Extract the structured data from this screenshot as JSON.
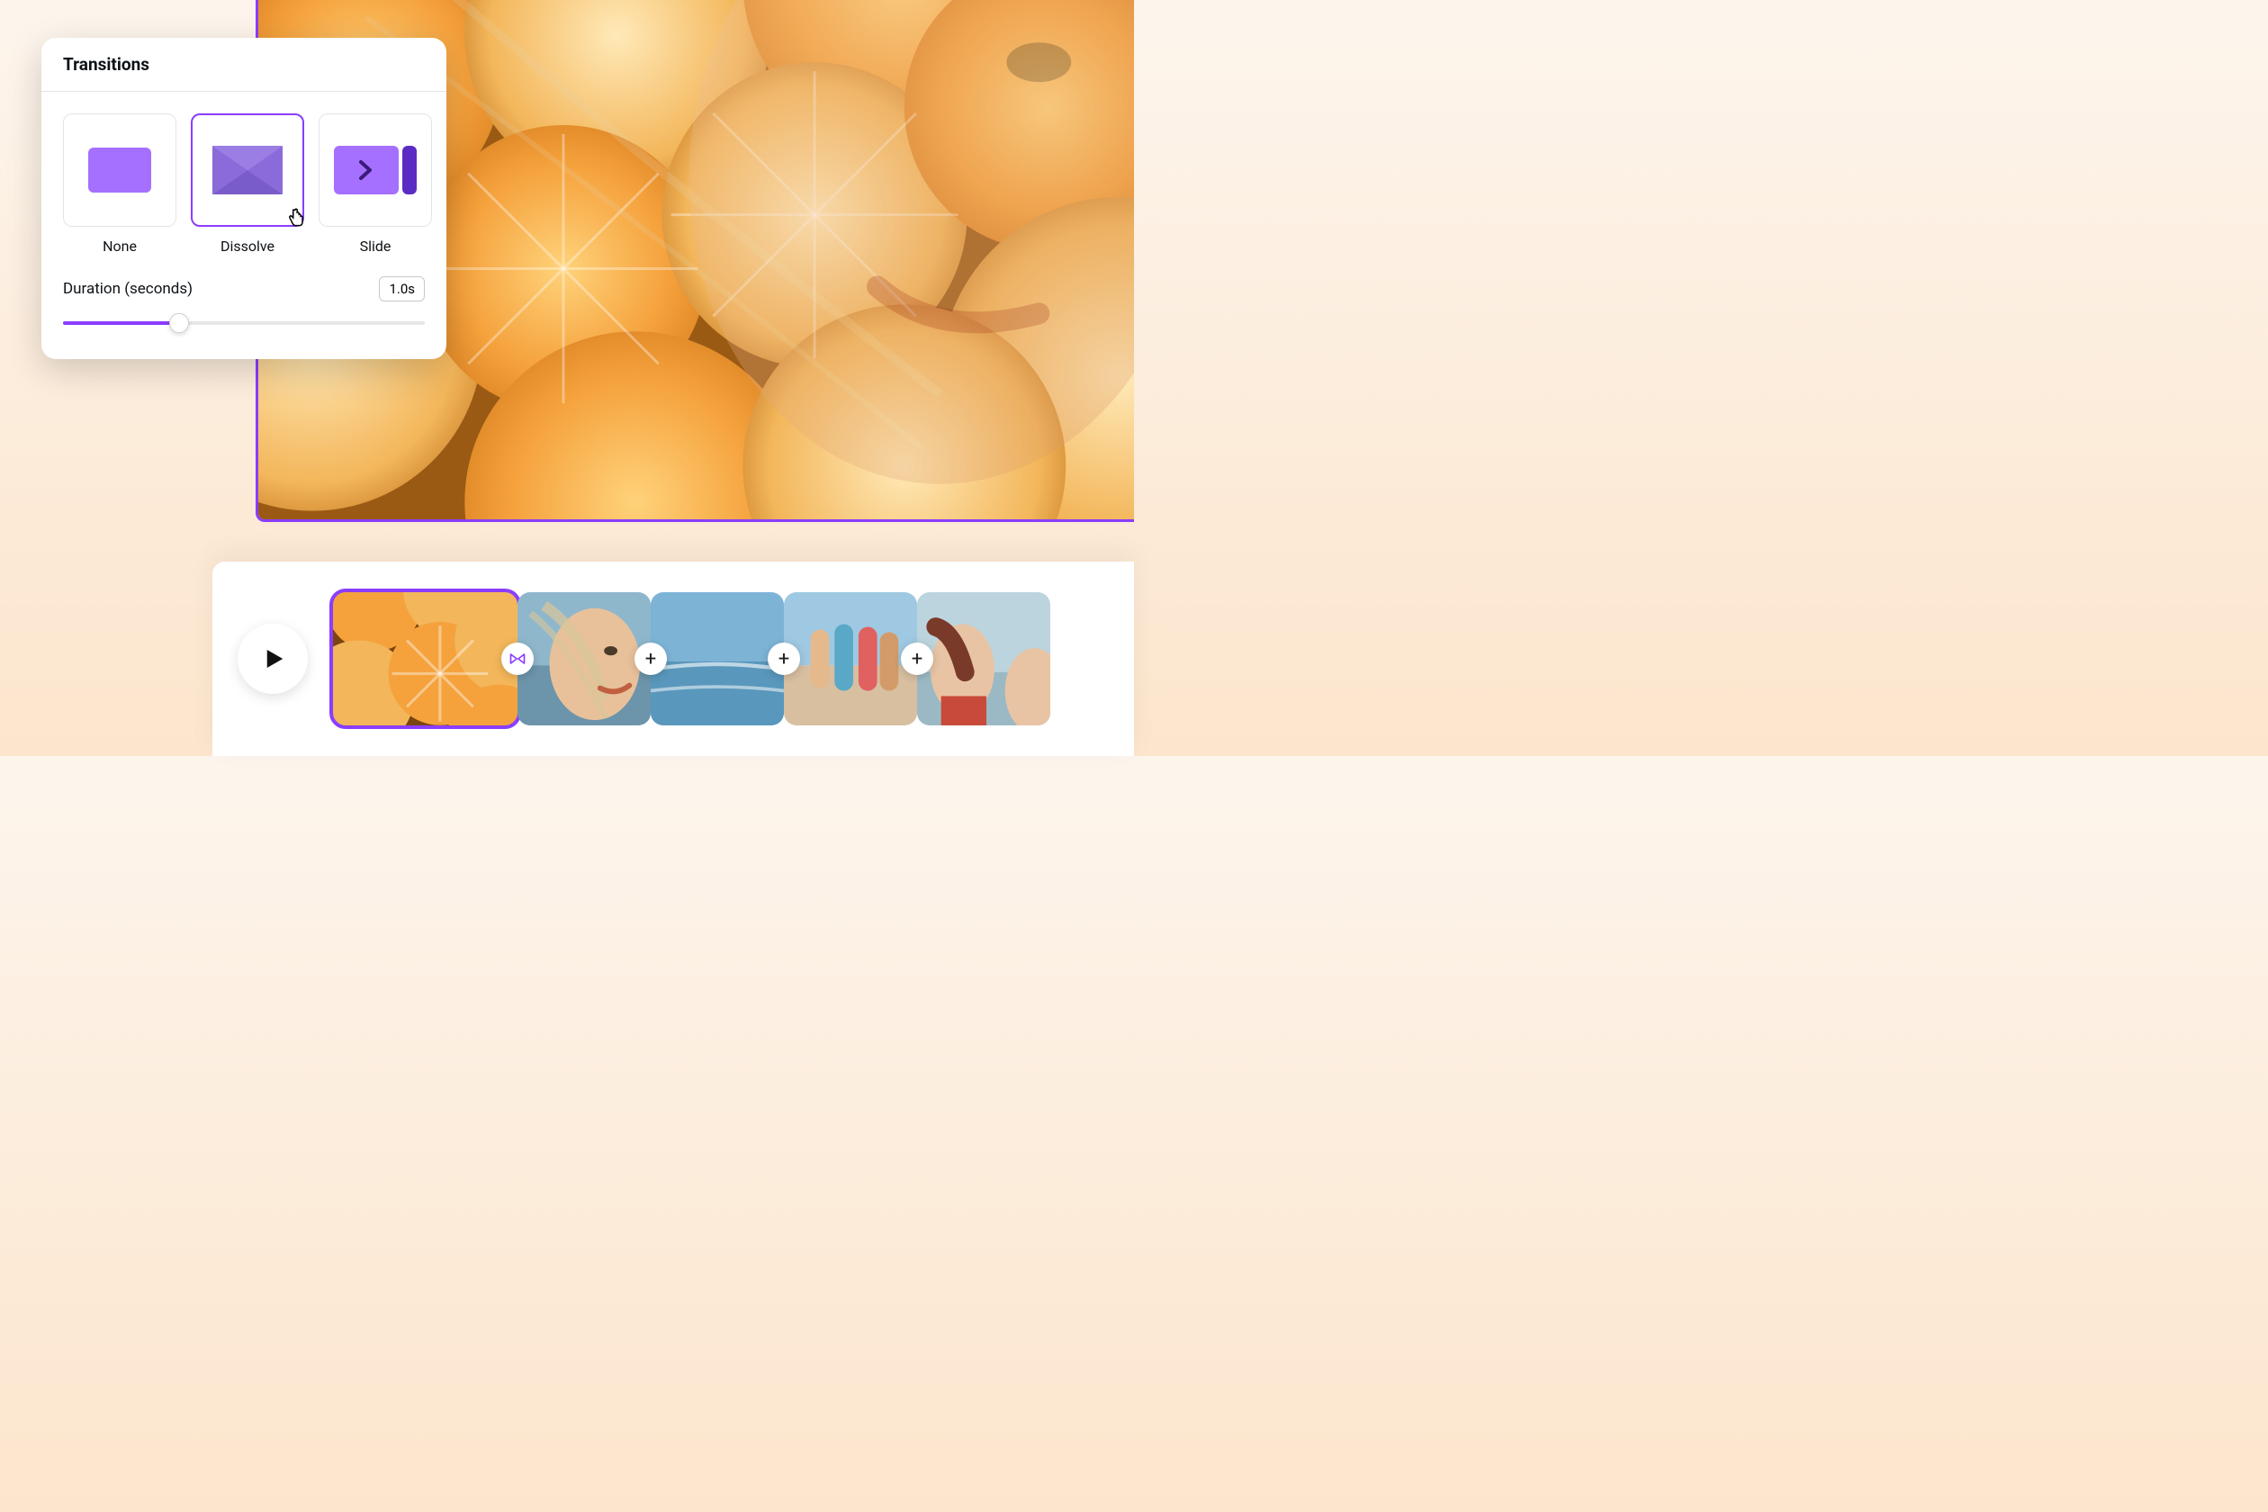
{
  "popover": {
    "title": "Transitions",
    "transitions": [
      {
        "id": "none",
        "label": "None",
        "selected": false
      },
      {
        "id": "dissolve",
        "label": "Dissolve",
        "selected": true
      },
      {
        "id": "slide",
        "label": "Slide",
        "selected": false
      }
    ],
    "duration": {
      "label": "Duration (seconds)",
      "value_text": "1.0s",
      "slider_percent": 32
    }
  },
  "timeline": {
    "play_icon": "play-icon",
    "clips": [
      {
        "id": "clip-oranges",
        "selected": true
      },
      {
        "id": "clip-woman-profile",
        "selected": false
      },
      {
        "id": "clip-ocean",
        "selected": false
      },
      {
        "id": "clip-group-beach",
        "selected": false
      },
      {
        "id": "clip-woman-water",
        "selected": false
      }
    ],
    "between": [
      {
        "type": "transition-applied",
        "icon": "bowtie-icon"
      },
      {
        "type": "add",
        "icon": "plus-icon"
      },
      {
        "type": "add",
        "icon": "plus-icon"
      },
      {
        "type": "add",
        "icon": "plus-icon"
      }
    ]
  },
  "colors": {
    "accent": "#8b3dff"
  }
}
